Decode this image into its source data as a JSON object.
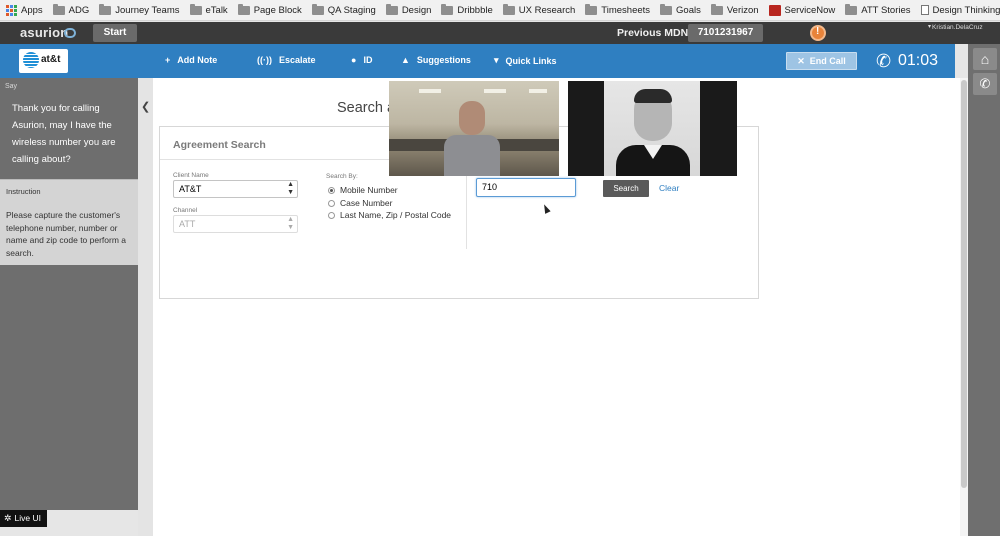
{
  "bookmarks": [
    {
      "label": "Apps",
      "icon": "apps-grid-icon"
    },
    {
      "label": "ADG",
      "icon": "folder-icon"
    },
    {
      "label": "Journey Teams",
      "icon": "folder-icon"
    },
    {
      "label": "eTalk",
      "icon": "folder-icon"
    },
    {
      "label": "Page Block",
      "icon": "folder-icon"
    },
    {
      "label": "QA Staging",
      "icon": "folder-icon"
    },
    {
      "label": "Design",
      "icon": "folder-icon"
    },
    {
      "label": "Dribbble",
      "icon": "folder-icon"
    },
    {
      "label": "UX Research",
      "icon": "folder-icon"
    },
    {
      "label": "Timesheets",
      "icon": "folder-icon"
    },
    {
      "label": "Goals",
      "icon": "folder-icon"
    },
    {
      "label": "Verizon",
      "icon": "folder-icon"
    },
    {
      "label": "ServiceNow",
      "icon": "servicenow-logo-icon"
    },
    {
      "label": "ATT Stories",
      "icon": "folder-icon"
    },
    {
      "label": "Design Thinking",
      "icon": "document-icon"
    }
  ],
  "header": {
    "brand": "asurion",
    "start_label": "Start",
    "previous_mdn_label": "Previous MDN:",
    "previous_mdn_value": "7101231967",
    "user_name": "Kristian.DelaCruz"
  },
  "toolbar": {
    "carrier_logo_text": "at&t",
    "items": [
      {
        "label": "Add Note",
        "icon": "plus-icon"
      },
      {
        "label": "Escalate",
        "icon": "escalate-icon"
      },
      {
        "label": "ID",
        "icon": "id-pin-icon"
      },
      {
        "label": "Suggestions",
        "icon": "flask-icon"
      },
      {
        "label": "Quick Links",
        "icon": "caret-down-icon"
      }
    ],
    "end_call_label": "End Call",
    "call_timer": "01:03"
  },
  "say": {
    "label": "Say",
    "text": "Thank you for calling Asurion, may I have the wireless number you are calling about?"
  },
  "instruction": {
    "label": "Instruction",
    "text": "Please capture the customer's telephone number, number or name and zip code to perform a search."
  },
  "main": {
    "heading": "Search a"
  },
  "agreement_search": {
    "title": "Agreement Search",
    "client_name_label": "Client Name",
    "client_name_value": "AT&T",
    "channel_label": "Channel",
    "channel_placeholder": "ATT",
    "search_by_label": "Search By:",
    "search_by_options": [
      {
        "label": "Mobile Number",
        "selected": true
      },
      {
        "label": "Case Number",
        "selected": false
      },
      {
        "label": "Last Name, Zip / Postal Code",
        "selected": false
      }
    ],
    "search_value": "710",
    "search_button": "Search",
    "clear_link": "Clear"
  },
  "footer": {
    "live_ui_label": "Live UI"
  },
  "colors": {
    "toolbar_blue": "#2f7fc1",
    "header_dark": "#3a3a3a",
    "sidebar_gray": "#6e6e6e",
    "alert_orange": "#e8833a"
  }
}
